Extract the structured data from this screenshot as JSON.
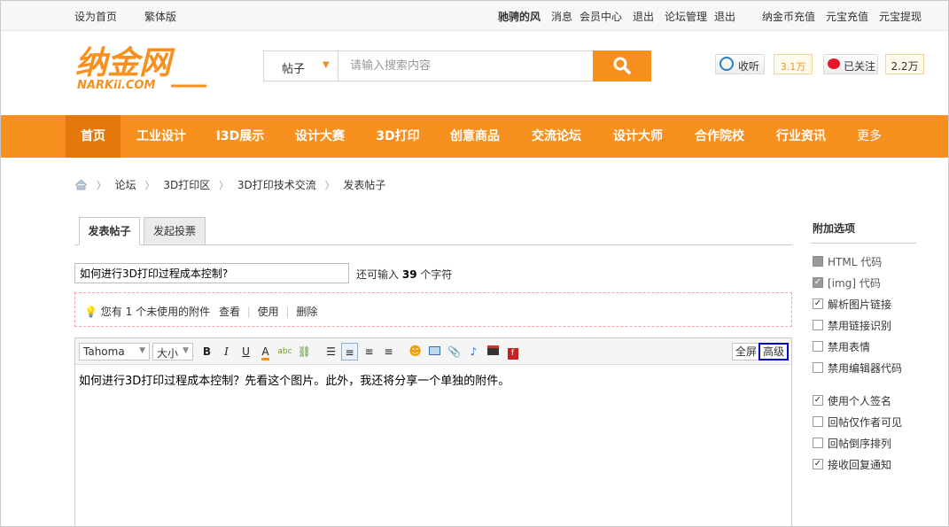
{
  "topbar": {
    "set_home": "设为首页",
    "traditional": "繁体版",
    "username": "驰骋的风",
    "messages": "消息",
    "member_center": "会员中心",
    "logout1": "退出",
    "forum_admin": "论坛管理",
    "logout2": "退出",
    "recharge_coin": "纳金币充值",
    "recharge_yuanbao": "元宝充值",
    "withdraw_yuanbao": "元宝提现"
  },
  "logo": {
    "text": "纳金网",
    "sub": "NARKii.COM"
  },
  "search": {
    "type": "帖子",
    "placeholder": "请输入搜索内容"
  },
  "social": {
    "listen": "收听",
    "listen_count": "3.1万",
    "follow": "已关注",
    "follow_count": "2.2万"
  },
  "nav": [
    "首页",
    "工业设计",
    "I3D展示",
    "设计大赛",
    "3D打印",
    "创意商品",
    "交流论坛",
    "设计大师",
    "合作院校",
    "行业资讯",
    "更多"
  ],
  "breadcrumb": [
    "论坛",
    "3D打印区",
    "3D打印技术交流",
    "发表帖子"
  ],
  "tabs": {
    "post": "发表帖子",
    "poll": "发起投票"
  },
  "title": {
    "value": "如何进行3D打印过程成本控制?",
    "remain_prefix": "还可输入",
    "remain_count": "39",
    "remain_suffix": "个字符"
  },
  "attach": {
    "prefix": "您有",
    "count": "1",
    "suffix": "个未使用的附件",
    "view": "查看",
    "use": "使用",
    "delete": "删除"
  },
  "editor": {
    "font": "Tahoma",
    "size": "大小",
    "fullscreen": "全屏",
    "advanced": "高级",
    "content": "如何进行3D打印过程成本控制？先看这个图片。此外，我还将分享一个单独的附件。"
  },
  "sidebar": {
    "heading": "附加选项",
    "options": [
      {
        "label": "HTML 代码",
        "checked": false,
        "disabled": true
      },
      {
        "label": "[img] 代码",
        "checked": true,
        "disabled": true
      },
      {
        "label": "解析图片链接",
        "checked": true,
        "disabled": false
      },
      {
        "label": "禁用链接识别",
        "checked": false,
        "disabled": false
      },
      {
        "label": "禁用表情",
        "checked": false,
        "disabled": false
      },
      {
        "label": "禁用编辑器代码",
        "checked": false,
        "disabled": false
      },
      {
        "label": "使用个人签名",
        "checked": true,
        "disabled": false
      },
      {
        "label": "回帖仅作者可见",
        "checked": false,
        "disabled": false
      },
      {
        "label": "回帖倒序排列",
        "checked": false,
        "disabled": false
      },
      {
        "label": "接收回复通知",
        "checked": true,
        "disabled": false
      }
    ]
  },
  "colors": {
    "brand_orange": "#f7901e",
    "nav_active": "#e5780a"
  }
}
